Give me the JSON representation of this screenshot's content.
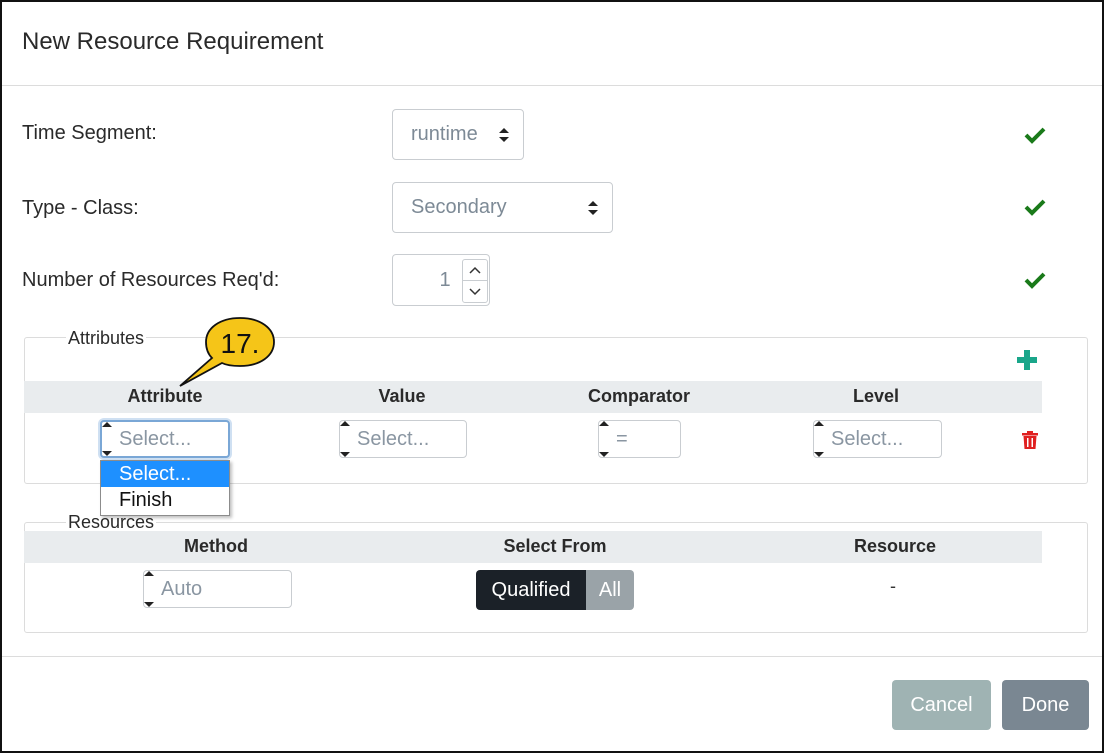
{
  "dialog": {
    "title": "New Resource Requirement"
  },
  "form": {
    "time_segment": {
      "label": "Time Segment:",
      "value": "runtime"
    },
    "type_class": {
      "label": "Type - Class:",
      "value": "Secondary"
    },
    "num_resources": {
      "label": "Number of Resources Req'd:",
      "value": "1"
    }
  },
  "attributes": {
    "legend": "Attributes",
    "columns": [
      "Attribute",
      "Value",
      "Comparator",
      "Level"
    ],
    "row": {
      "attribute": "Select...",
      "value": "Select...",
      "comparator": "=",
      "level": "Select..."
    },
    "attribute_dropdown_options": [
      "Select...",
      "Finish"
    ],
    "selected_option_index": 0
  },
  "callout": {
    "label": "17."
  },
  "resources": {
    "legend": "Resources",
    "columns": [
      "Method",
      "Select From",
      "Resource"
    ],
    "method": "Auto",
    "select_from_options": [
      "Qualified",
      "All"
    ],
    "select_from_active": "Qualified",
    "resource_value": "-"
  },
  "footer": {
    "cancel_label": "Cancel",
    "done_label": "Done"
  },
  "icons": {
    "check": "check-icon",
    "plus": "plus-icon",
    "trash": "trash-icon"
  },
  "colors": {
    "check_green": "#1a7a1a",
    "plus_teal": "#1aa68a",
    "trash_red": "#e02020",
    "dropdown_highlight": "#1e90ff",
    "callout_fill": "#f5c518",
    "cancel_bg": "#9fb3b3",
    "done_bg": "#7a8792",
    "toggle_active": "#1b2128",
    "toggle_inactive": "#9aa3a8"
  }
}
